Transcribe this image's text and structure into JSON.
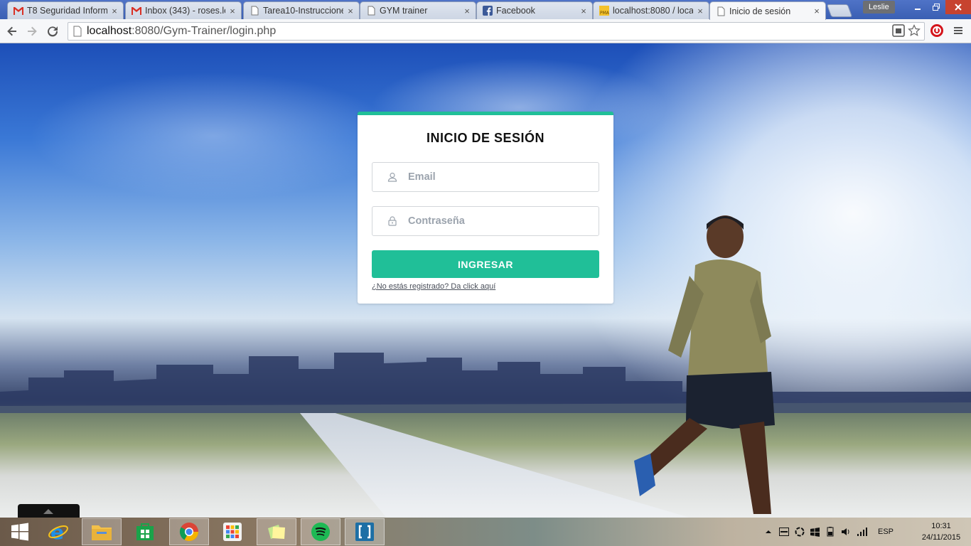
{
  "browser": {
    "tabs": [
      {
        "title": "T8 Seguridad Inform",
        "icon": "gmail-icon"
      },
      {
        "title": "Inbox (343) - roses.le",
        "icon": "gmail-icon"
      },
      {
        "title": "Tarea10-Instruccione",
        "icon": "page-icon"
      },
      {
        "title": "GYM trainer",
        "icon": "page-icon"
      },
      {
        "title": "Facebook",
        "icon": "facebook-icon"
      },
      {
        "title": "localhost:8080 / loca",
        "icon": "phpmyadmin-icon"
      },
      {
        "title": "Inicio de sesión",
        "icon": "page-icon",
        "active": true
      }
    ],
    "close_glyph": "×",
    "profile_name": "Leslie",
    "url_host": "localhost",
    "url_path": ":8080/Gym-Trainer/login.php"
  },
  "login": {
    "title": "INICIO DE SESIÓN",
    "email_placeholder": "Email",
    "password_placeholder": "Contraseña",
    "submit_label": "INGRESAR",
    "register_link": "¿No estás registrado? Da click aquí",
    "accent_color": "#20bf98"
  },
  "taskbar": {
    "apps": [
      "windows-start-icon",
      "internet-explorer-icon",
      "file-explorer-icon",
      "windows-store-icon",
      "chrome-icon",
      "apps-grid-icon",
      "sticky-notes-icon",
      "spotify-icon",
      "brackets-icon"
    ],
    "tray_language": "ESP",
    "clock_time": "10:31",
    "clock_date": "24/11/2015"
  }
}
